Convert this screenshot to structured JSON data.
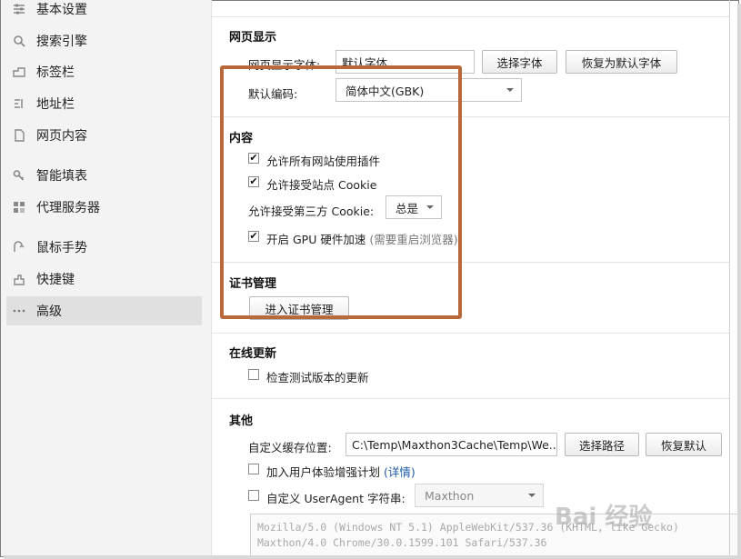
{
  "sidebar": {
    "items": [
      {
        "label": "基本设置",
        "icon": "sliders-icon"
      },
      {
        "label": "搜索引擎",
        "icon": "search-icon"
      },
      {
        "label": "标签栏",
        "icon": "tabs-icon"
      },
      {
        "label": "地址栏",
        "icon": "address-bar-icon"
      },
      {
        "label": "网页内容",
        "icon": "page-icon"
      },
      {
        "label": "智能填表",
        "icon": "key-icon"
      },
      {
        "label": "代理服务器",
        "icon": "proxy-icon"
      },
      {
        "label": "鼠标手势",
        "icon": "mouse-gesture-icon"
      },
      {
        "label": "快捷键",
        "icon": "shortcut-icon"
      },
      {
        "label": "高级",
        "icon": "more-icon"
      }
    ],
    "active": "高级"
  },
  "web_display": {
    "title": "网页显示",
    "font_label": "网页显示字体:",
    "font_value": "默认字体",
    "choose_font_button": "选择字体",
    "restore_font_button": "恢复为默认字体",
    "encoding_label": "默认编码:",
    "encoding_value": "简体中文(GBK)"
  },
  "content": {
    "title": "内容",
    "allow_plugins": "允许所有网站使用插件",
    "allow_plugins_checked": true,
    "accept_cookie": "允许接受站点 Cookie",
    "accept_cookie_checked": true,
    "third_party_label": "允许接受第三方 Cookie:",
    "third_party_value": "总是",
    "gpu_label": "开启 GPU 硬件加速",
    "gpu_note": "(需要重启浏览器)",
    "gpu_checked": true
  },
  "cert": {
    "title": "证书管理",
    "button": "进入证书管理"
  },
  "update": {
    "title": "在线更新",
    "check_beta": "检查测试版本的更新",
    "check_beta_checked": false
  },
  "other": {
    "title": "其他",
    "cache_label": "自定义缓存位置:",
    "cache_value": "C:\\Temp\\Maxthon3Cache\\Temp\\We...",
    "choose_path_button": "选择路径",
    "restore_default_button": "恢复默认",
    "ux_plan": "加入用户体验增强计划",
    "ux_plan_link": "(详情)",
    "ux_plan_checked": false,
    "custom_ua_label": "自定义 UserAgent 字符串:",
    "custom_ua_checked": false,
    "ua_select": "Maxthon",
    "ua_line1": "Mozilla/5.0 (Windows NT 5.1) AppleWebKit/537.36 (KHTML, like Gecko)",
    "ua_line2": "Maxthon/4.0 Chrome/30.0.1599.101 Safari/537.36"
  },
  "watermark": "Bai 经验",
  "colors": {
    "highlight": "#b8693a",
    "sidebar_bg": "#f3f3f3",
    "active_bg": "#e0e0e0",
    "link": "#1c5aa6"
  }
}
